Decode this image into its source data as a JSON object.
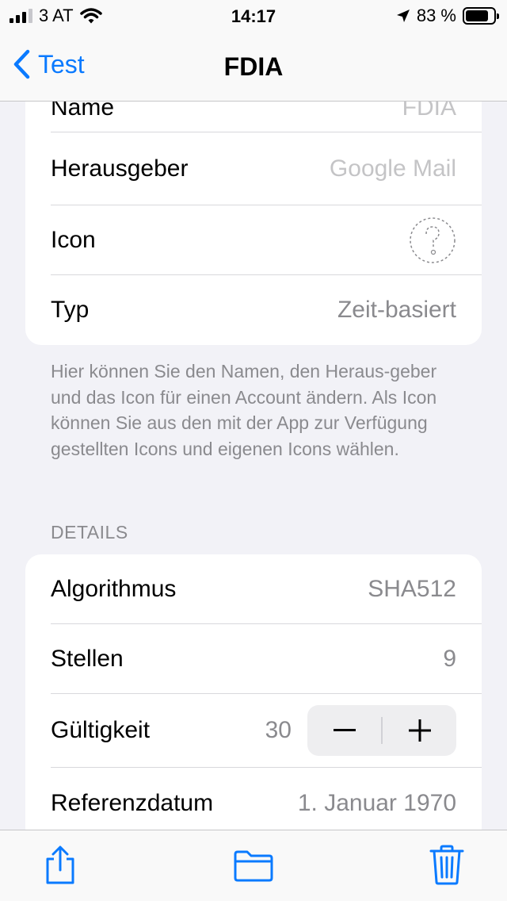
{
  "status": {
    "carrier": "3 AT",
    "time": "14:17",
    "battery": "83 %",
    "battery_level": 0.83
  },
  "nav": {
    "back_label": "Test",
    "title": "FDIA"
  },
  "general_card": {
    "rows": [
      {
        "label": "Name",
        "value": "FDIA"
      },
      {
        "label": "Herausgeber",
        "value": "Google Mail"
      },
      {
        "label": "Icon",
        "icon": "question-mark-icon"
      },
      {
        "label": "Typ",
        "value": "Zeit-basiert"
      }
    ]
  },
  "general_footer": "Hier können Sie den Namen, den Heraus-geber und das Icon für einen Account ändern. Als Icon können Sie aus den mit der App zur Verfügung gestellten Icons und eigenen Icons wählen.",
  "details": {
    "header": "DETAILS",
    "rows": [
      {
        "label": "Algorithmus",
        "value": "SHA512"
      },
      {
        "label": "Stellen",
        "value": "9"
      },
      {
        "label": "Gültigkeit",
        "value": "30"
      },
      {
        "label": "Referenzdatum",
        "value": "1. Januar 1970"
      }
    ]
  },
  "toolbar": {
    "icons": [
      "share-icon",
      "folder-icon",
      "trash-icon"
    ]
  },
  "colors": {
    "accent": "#0a7aff",
    "background": "#f2f2f7",
    "secondary_text": "#8a8a8e"
  }
}
